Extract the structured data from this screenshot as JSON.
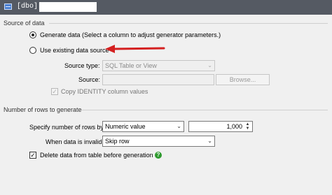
{
  "title_bar": {
    "text": "[dbo]."
  },
  "source_group": {
    "label": "Source of data",
    "generate_option": "Generate data (Select a column to adjust generator parameters.)",
    "existing_option": "Use existing data source",
    "source_type_label": "Source type:",
    "source_type_value": "SQL Table or View",
    "source_label": "Source:",
    "source_value": "",
    "browse_button": "Browse...",
    "copy_identity_label": "Copy IDENTITY column values"
  },
  "rows_group": {
    "label": "Number of rows to generate",
    "specify_label": "Specify number of rows by:",
    "specify_value": "Numeric value",
    "rows_count": "1,000",
    "invalid_label": "When data is invalid:",
    "invalid_value": "Skip row",
    "delete_label": "Delete data from table before generation"
  },
  "colors": {
    "arrow": "#d42020",
    "help": "#2e9a2e",
    "titlebar": "#555a63"
  },
  "icons": [
    "table-icon",
    "chevron-down-icon",
    "spinner-arrows-icon",
    "help-icon",
    "red-arrow-icon",
    "checkmark-icon"
  ]
}
